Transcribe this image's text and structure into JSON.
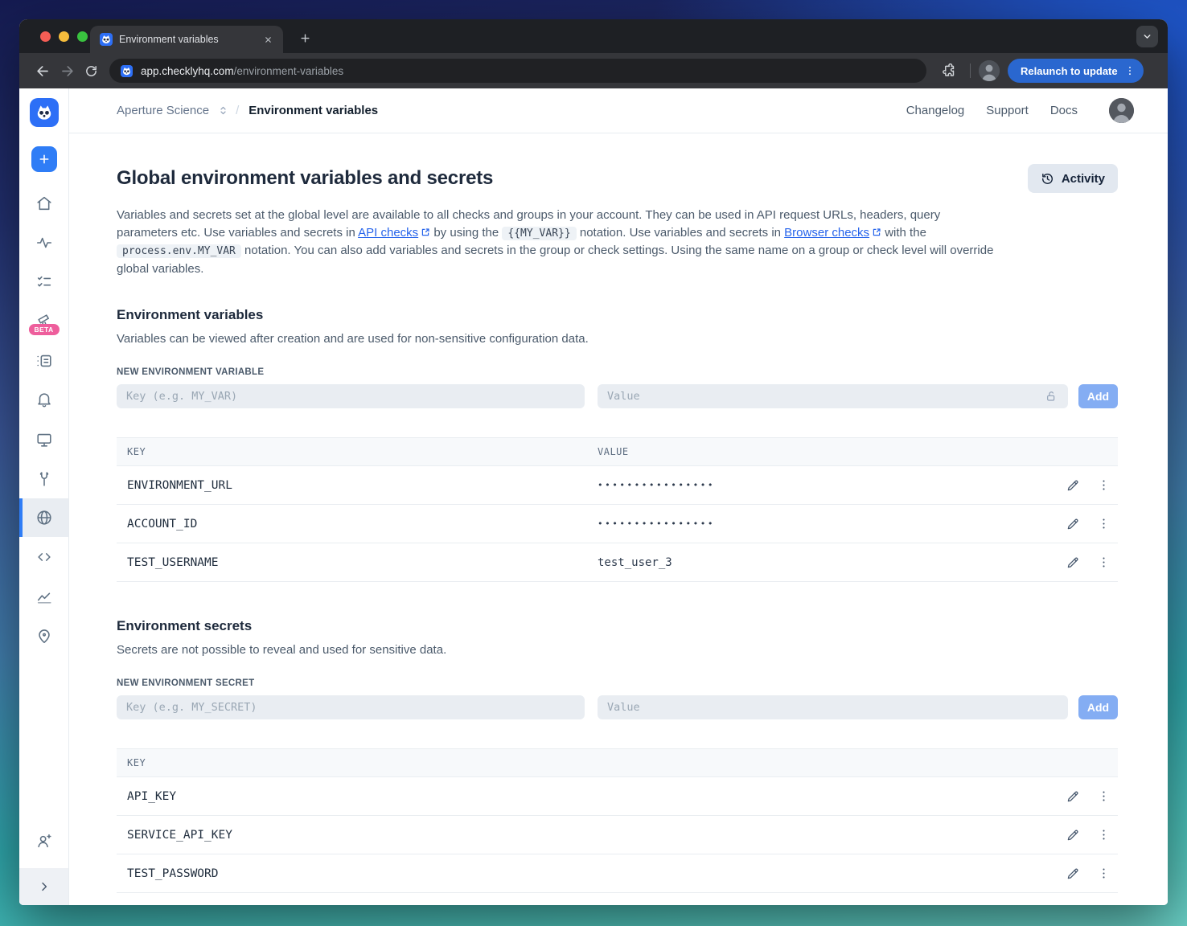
{
  "colors": {
    "brand_blue": "#2d6ff6",
    "sidebar_active_blue": "#2f7df6",
    "badge_pink": "#ee5e9c",
    "link_blue": "#2563eb",
    "relaunch_blue": "#2a67cf",
    "add_button_blue": "#84adf3"
  },
  "browser": {
    "tab_title": "Environment variables",
    "url_host": "app.checklyhq.com",
    "url_path": "/environment-variables",
    "relaunch_label": "Relaunch to update"
  },
  "app_header": {
    "account": "Aperture Science",
    "divider": "/",
    "page": "Environment variables",
    "nav": [
      {
        "label": "Changelog"
      },
      {
        "label": "Support"
      },
      {
        "label": "Docs"
      }
    ]
  },
  "sidebar": {
    "beta_badge": "BETA"
  },
  "main": {
    "title": "Global environment variables and secrets",
    "activity_label": "Activity",
    "intro": {
      "p1": "Variables and secrets set at the global level are available to all checks and groups in your account. They can be used in API request URLs, headers, query parameters etc. Use variables and secrets in ",
      "link1": "API checks",
      "p2": " by using the ",
      "code1": "{{MY_VAR}}",
      "p3": " notation. Use variables and secrets in ",
      "link2": "Browser checks",
      "p4": " with the ",
      "code2": "process.env.MY_VAR",
      "p5": " notation. You can also add variables and secrets in the group or check settings. Using the same name on a group or check level will override global variables."
    }
  },
  "variables": {
    "heading": "Environment variables",
    "description": "Variables can be viewed after creation and are used for non-sensitive configuration data.",
    "new_label": "NEW ENVIRONMENT VARIABLE",
    "key_placeholder": "Key (e.g. MY_VAR)",
    "value_placeholder": "Value",
    "add_label": "Add",
    "col_key": "KEY",
    "col_value": "VALUE",
    "rows": [
      {
        "key": "ENVIRONMENT_URL",
        "value": "••••••••••••••••"
      },
      {
        "key": "ACCOUNT_ID",
        "value": "••••••••••••••••"
      },
      {
        "key": "TEST_USERNAME",
        "value": "test_user_3"
      }
    ]
  },
  "secrets": {
    "heading": "Environment secrets",
    "description": "Secrets are not possible to reveal and used for sensitive data.",
    "new_label": "NEW ENVIRONMENT SECRET",
    "key_placeholder": "Key (e.g. MY_SECRET)",
    "value_placeholder": "Value",
    "add_label": "Add",
    "col_key": "KEY",
    "rows": [
      {
        "key": "API_KEY"
      },
      {
        "key": "SERVICE_API_KEY"
      },
      {
        "key": "TEST_PASSWORD"
      }
    ]
  }
}
